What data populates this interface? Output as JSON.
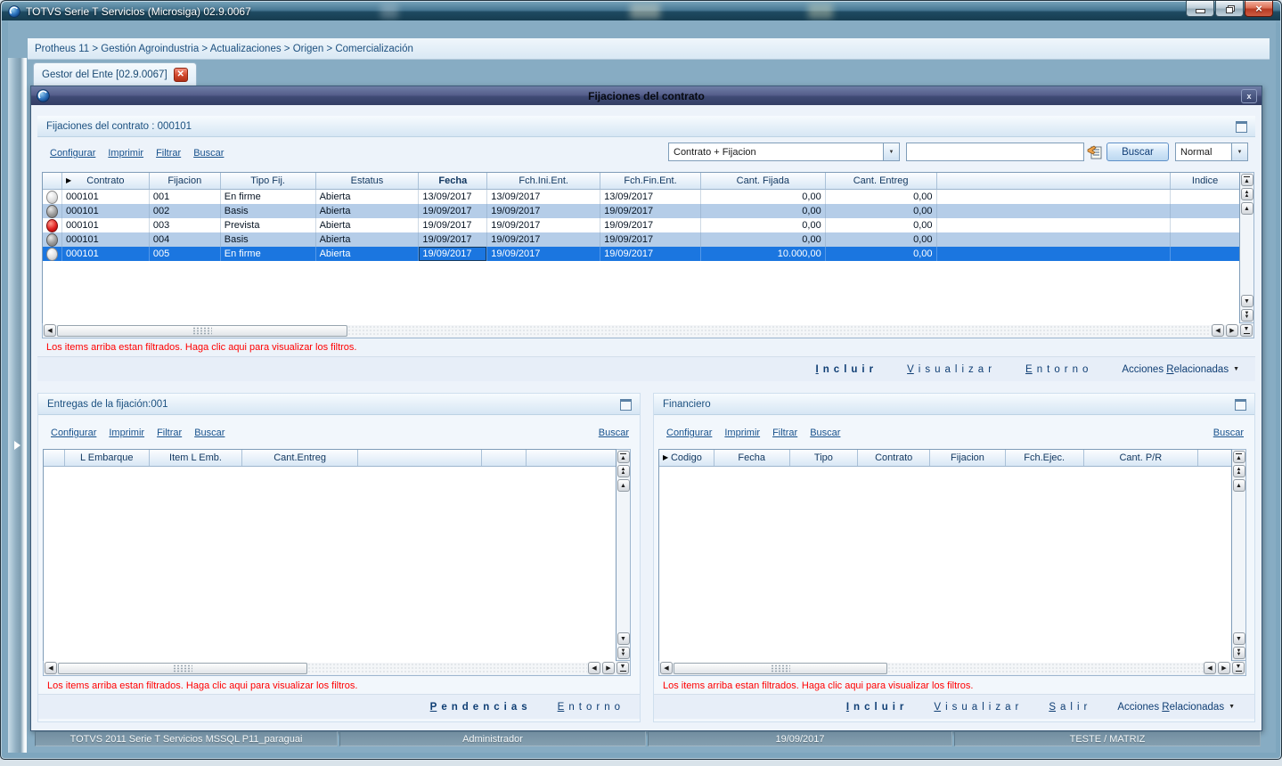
{
  "window": {
    "title": "TOTVS Serie T Servicios (Microsiga) 02.9.0067"
  },
  "breadcrumb": {
    "path": "Protheus 11 > Gestión Agroindustria > Actualizaciones > Origen > Comercialización"
  },
  "tab": {
    "label": "Gestor del Ente [02.9.0067]"
  },
  "dialog": {
    "title": "Fijaciones del contrato"
  },
  "top_panel": {
    "title": "Fijaciones del contrato : 000101",
    "links": {
      "configurar": "Configurar",
      "imprimir": "Imprimir",
      "filtrar": "Filtrar",
      "buscar": "Buscar"
    },
    "search": {
      "index": "Contrato + Fijacion",
      "query": "",
      "button": "Buscar",
      "mode": "Normal"
    },
    "grid": {
      "columns": [
        "",
        "Contrato",
        "Fijacion",
        "Tipo Fij.",
        "Estatus",
        "Fecha",
        "Fch.Ini.Ent.",
        "Fch.Fin.Ent.",
        "Cant. Fijada",
        "Cant. Entreg",
        "",
        "Indice"
      ],
      "rows": [
        {
          "status": "silver",
          "contrato": "000101",
          "fijacion": "001",
          "tipo_fij": "En firme",
          "estatus": "Abierta",
          "fecha": "13/09/2017",
          "fch_ini_ent": "13/09/2017",
          "fch_fin_ent": "13/09/2017",
          "cant_fijada": "0,00",
          "cant_entreg": "0,00",
          "extra": "",
          "indice": ""
        },
        {
          "status": "gray",
          "contrato": "000101",
          "fijacion": "002",
          "tipo_fij": "Basis",
          "estatus": "Abierta",
          "fecha": "19/09/2017",
          "fch_ini_ent": "19/09/2017",
          "fch_fin_ent": "19/09/2017",
          "cant_fijada": "0,00",
          "cant_entreg": "0,00",
          "extra": "",
          "indice": ""
        },
        {
          "status": "red",
          "contrato": "000101",
          "fijacion": "003",
          "tipo_fij": "Prevista",
          "estatus": "Abierta",
          "fecha": "19/09/2017",
          "fch_ini_ent": "19/09/2017",
          "fch_fin_ent": "19/09/2017",
          "cant_fijada": "0,00",
          "cant_entreg": "0,00",
          "extra": "",
          "indice": ""
        },
        {
          "status": "gray",
          "contrato": "000101",
          "fijacion": "004",
          "tipo_fij": "Basis",
          "estatus": "Abierta",
          "fecha": "19/09/2017",
          "fch_ini_ent": "19/09/2017",
          "fch_fin_ent": "19/09/2017",
          "cant_fijada": "0,00",
          "cant_entreg": "0,00",
          "extra": "",
          "indice": ""
        },
        {
          "status": "silver",
          "selected": true,
          "contrato": "000101",
          "fijacion": "005",
          "tipo_fij": "En firme",
          "estatus": "Abierta",
          "fecha": "19/09/2017",
          "fch_ini_ent": "19/09/2017",
          "fch_fin_ent": "19/09/2017",
          "cant_fijada": "10.000,00",
          "cant_entreg": "0,00",
          "extra": "",
          "indice": ""
        }
      ]
    },
    "notice": "Los items arriba estan filtrados. Haga clic aqui para visualizar los filtros.",
    "actions": [
      {
        "label": "Incluir",
        "accel": 0,
        "bold": true
      },
      {
        "label": "Visualizar",
        "accel": 0
      },
      {
        "label": "Entorno",
        "accel": 0
      },
      {
        "label": "Acciones Relacionadas",
        "accel": 9,
        "menu": true
      }
    ]
  },
  "entregas_panel": {
    "title": "Entregas de la fijación:001",
    "links": {
      "configurar": "Configurar",
      "imprimir": "Imprimir",
      "filtrar": "Filtrar",
      "buscar": "Buscar",
      "buscar_right": "Buscar"
    },
    "grid": {
      "columns": [
        "",
        "L Embarque",
        "Item L Emb.",
        "Cant.Entreg",
        "",
        "",
        ""
      ]
    },
    "notice": "Los items arriba estan filtrados. Haga clic aqui para visualizar los filtros.",
    "actions": [
      {
        "label": "Pendencias",
        "accel": 0,
        "bold": true
      },
      {
        "label": "Entorno",
        "accel": 0
      }
    ]
  },
  "financiero_panel": {
    "title": "Financiero",
    "links": {
      "configurar": "Configurar",
      "imprimir": "Imprimir",
      "filtrar": "Filtrar",
      "buscar": "Buscar",
      "buscar_right": "Buscar"
    },
    "grid": {
      "columns": [
        "Codigo",
        "Fecha",
        "Tipo",
        "Contrato",
        "Fijacion",
        "Fch.Ejec.",
        "Cant. P/R",
        ""
      ]
    },
    "notice": "Los items arriba estan filtrados. Haga clic aqui para visualizar los filtros.",
    "actions": [
      {
        "label": "Incluir",
        "accel": 0,
        "bold": true
      },
      {
        "label": "Visualizar",
        "accel": 0
      },
      {
        "label": "Salir",
        "accel": 0
      },
      {
        "label": "Acciones Relacionadas",
        "accel": 9,
        "menu": true
      }
    ]
  },
  "statusbar": {
    "cells": [
      "TOTVS 2011 Serie T Servicios MSSQL P11_paraguai",
      "Administrador",
      "19/09/2017",
      "TESTE / MATRIZ"
    ]
  }
}
